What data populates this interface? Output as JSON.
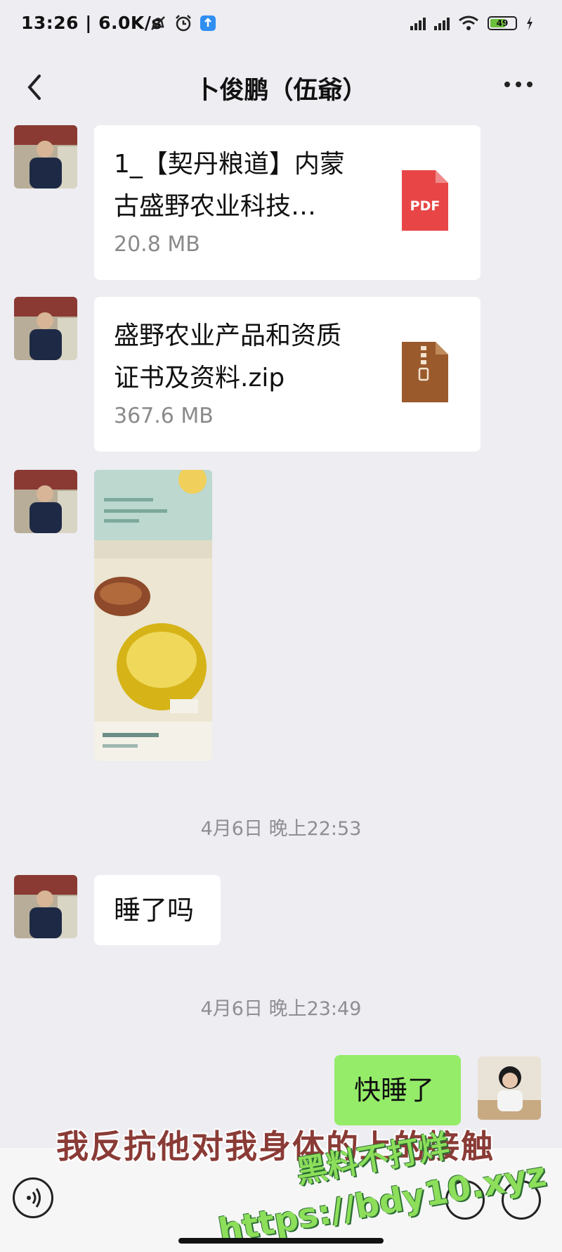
{
  "status_bar": {
    "time": "13:26",
    "speed": "6.0K/s",
    "battery": "49",
    "icons": [
      "mute-icon",
      "alarm-icon",
      "app-notification-icon",
      "signal-icon",
      "signal-icon",
      "wifi-icon",
      "battery-icon",
      "charging-icon"
    ]
  },
  "nav": {
    "title": "卜俊鹏（伍爺）"
  },
  "messages": [
    {
      "type": "file",
      "name_line1": "1_【契丹粮道】内蒙",
      "name_line2": "古盛野农业科技…",
      "size": "20.8 MB",
      "icon": "pdf-icon",
      "icon_text": "PDF"
    },
    {
      "type": "file",
      "name_line1": "盛野农业产品和资质",
      "name_line2": "证书及资料.zip",
      "size": "367.6 MB",
      "icon": "zip-icon"
    },
    {
      "type": "image"
    },
    {
      "type": "timestamp",
      "text": "4月6日 晚上22:53"
    },
    {
      "type": "text",
      "text": "睡了吗"
    },
    {
      "type": "timestamp",
      "text": "4月6日 晚上23:49"
    },
    {
      "type": "sent_text",
      "text": "快睡了"
    }
  ],
  "overlay": {
    "subtitle": "我反抗他对我身体的上的接触",
    "watermark_line1": "黑料不打烊",
    "watermark_line2": "https://bdy10.xyz"
  },
  "colors": {
    "background": "#ededf2",
    "sent_bubble": "#95ec69",
    "pdf_red": "#e84646",
    "zip_brown": "#9a5a2c"
  }
}
